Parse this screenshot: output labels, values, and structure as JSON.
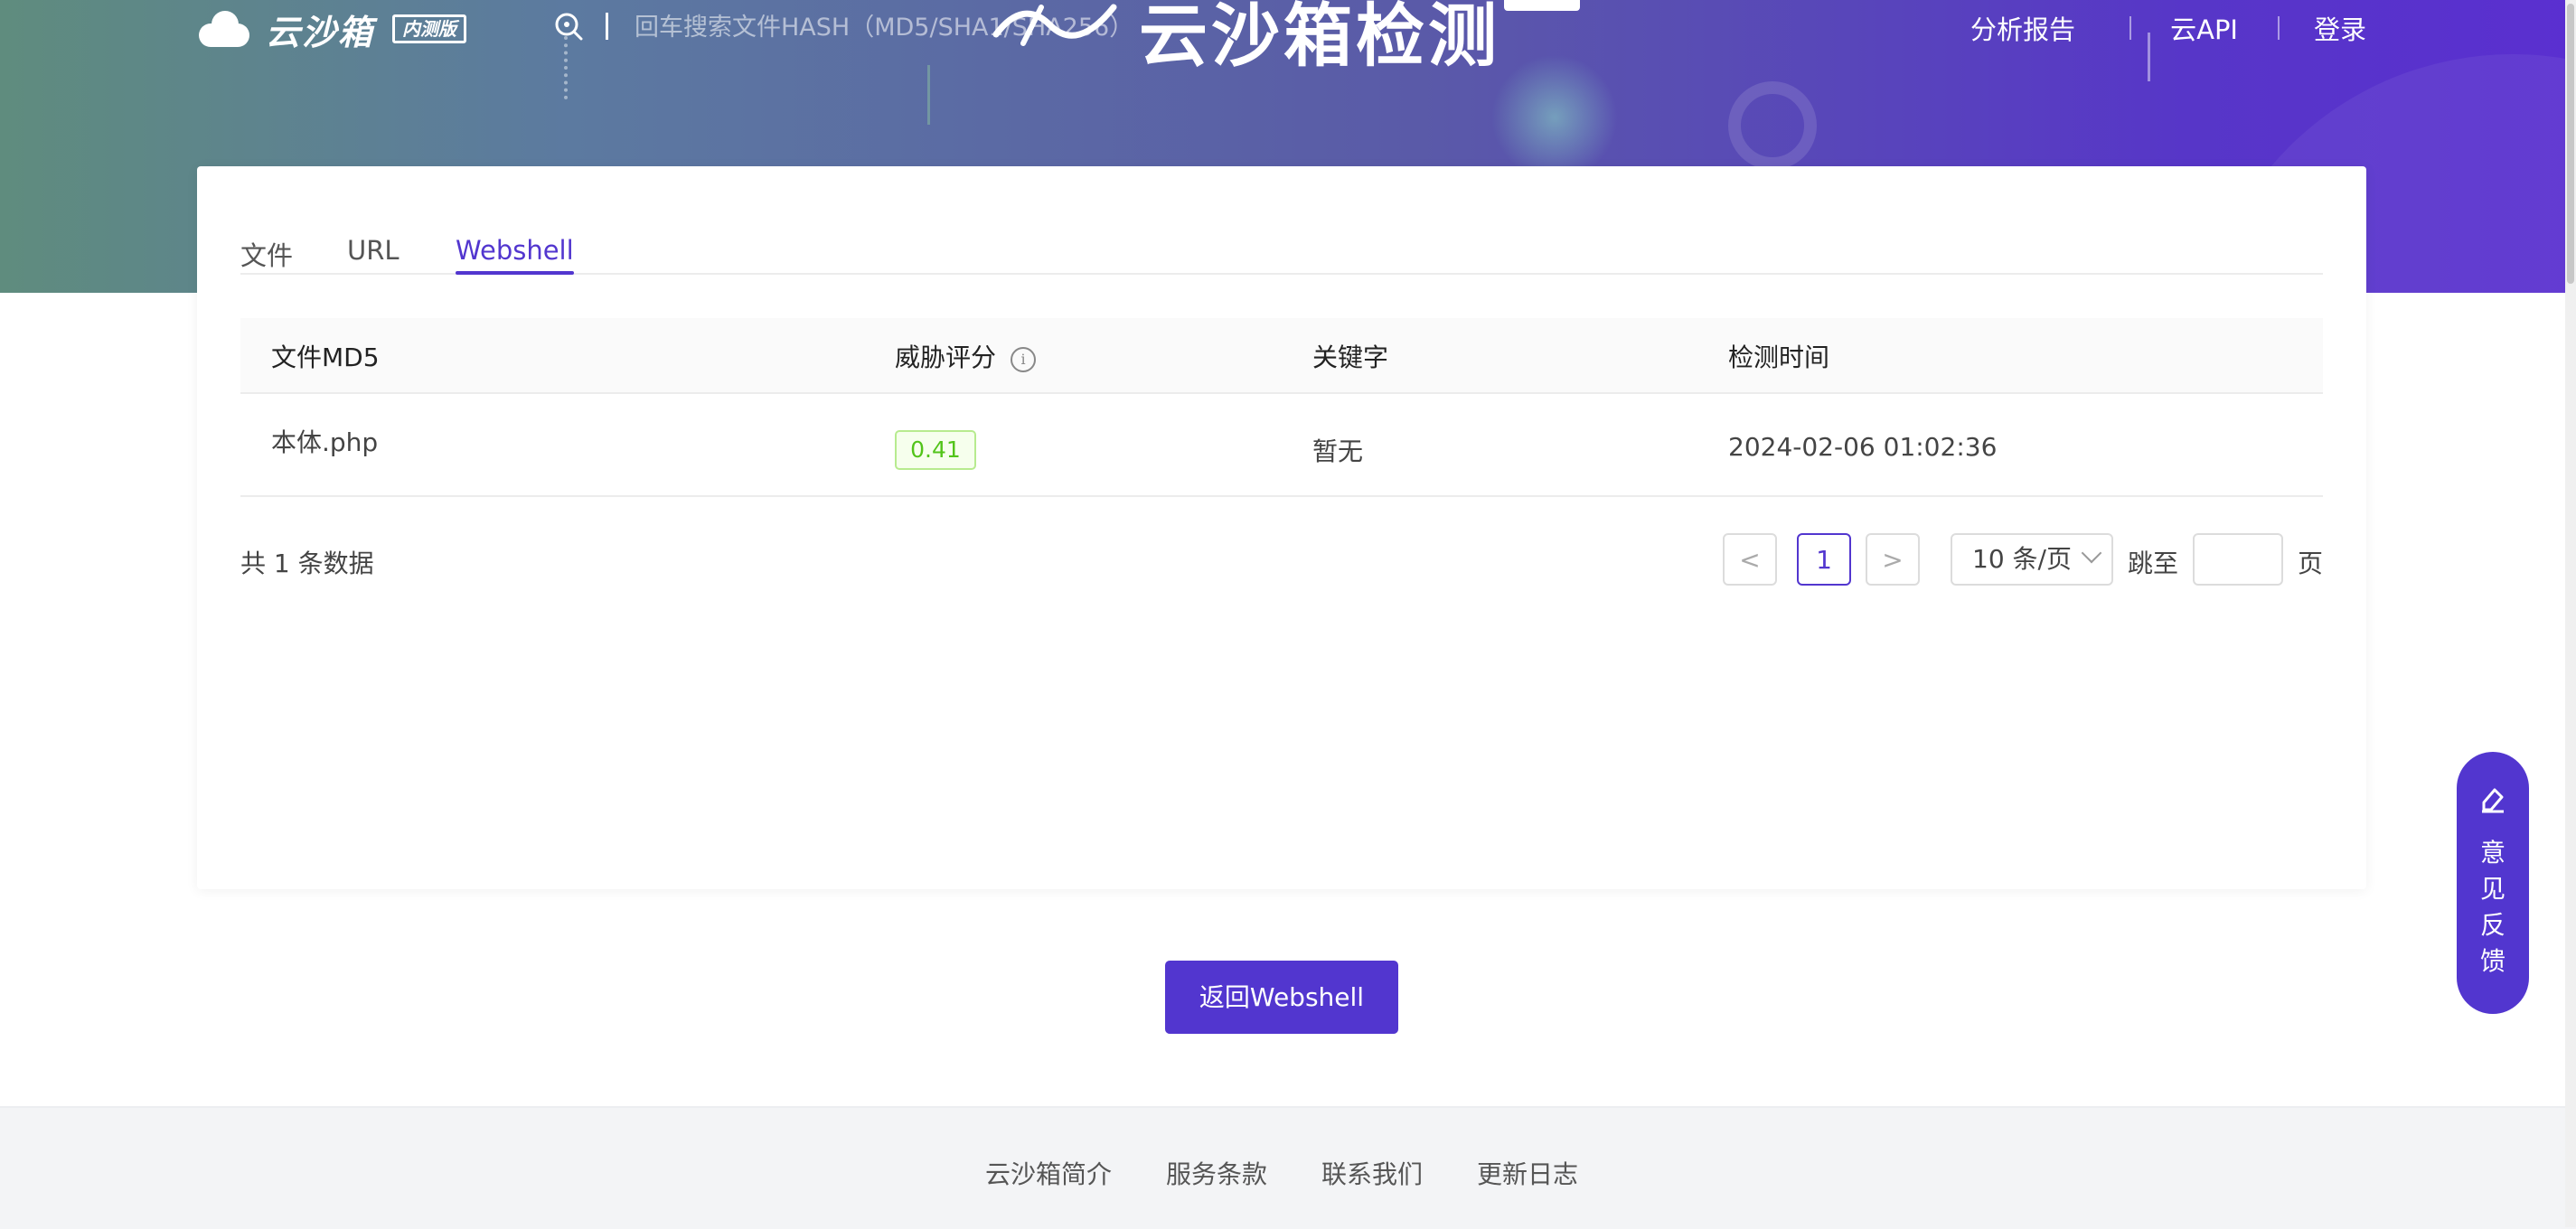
{
  "header": {
    "logo_text": "云沙箱",
    "logo_badge": "内测版",
    "search_placeholder": "回车搜索文件HASH（MD5/SHA1/SHA256）",
    "hero_title": "云沙箱检测",
    "nav": [
      {
        "label": "分析报告"
      },
      {
        "label": "云API"
      },
      {
        "label": "登录"
      }
    ]
  },
  "tabs": [
    {
      "label": "文件"
    },
    {
      "label": "URL"
    },
    {
      "label": "Webshell"
    }
  ],
  "active_tab": "Webshell",
  "table": {
    "columns": [
      "文件MD5",
      "威胁评分",
      "关键字",
      "检测时间"
    ],
    "rows": [
      {
        "file": "本体.php",
        "score": "0.41",
        "keyword": "暂无",
        "time": "2024-02-06 01:02:36"
      }
    ]
  },
  "pagination": {
    "total_text": "共 1 条数据",
    "prev": "<",
    "current_page": "1",
    "next": ">",
    "page_size": "10 条/页",
    "jump_prefix": "跳至",
    "jump_suffix": "页"
  },
  "back_button": "返回Webshell",
  "footer": {
    "links": [
      "云沙箱简介",
      "服务条款",
      "联系我们",
      "更新日志"
    ]
  },
  "feedback": {
    "label": "意\n见\n反\n馈"
  },
  "colors": {
    "accent": "#5236cf",
    "score_green": "#52c41a"
  }
}
